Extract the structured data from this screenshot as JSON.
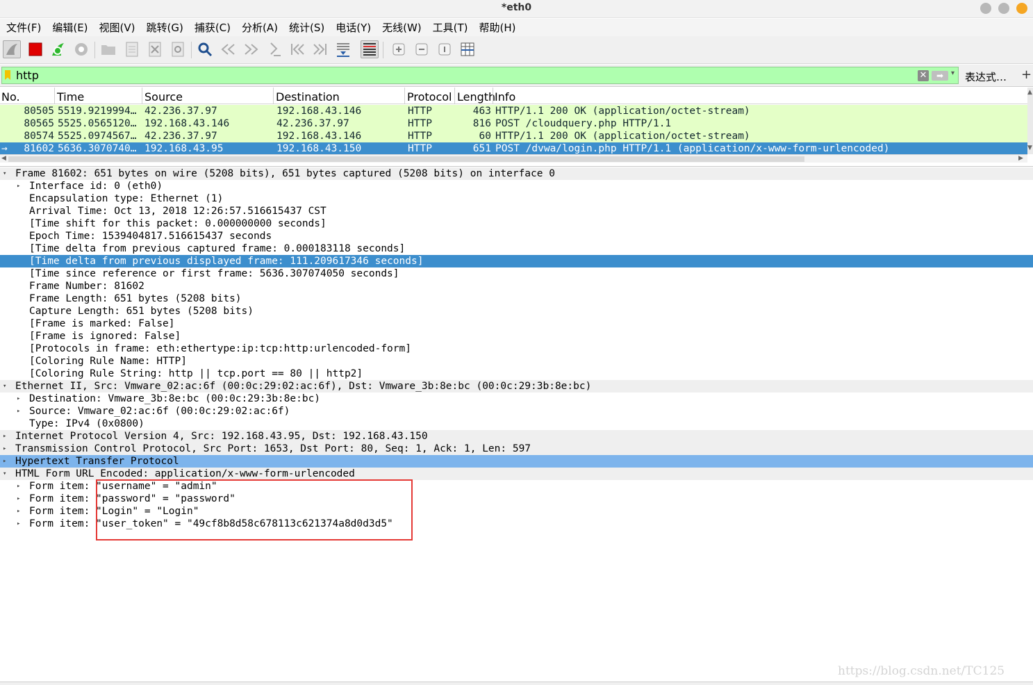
{
  "window": {
    "title": "*eth0"
  },
  "menu": [
    "文件(F)",
    "编辑(E)",
    "视图(V)",
    "跳转(G)",
    "捕获(C)",
    "分析(A)",
    "统计(S)",
    "电话(Y)",
    "无线(W)",
    "工具(T)",
    "帮助(H)"
  ],
  "toolbar": {
    "icons": [
      "shark-fin-start-icon",
      "stop-capture-icon",
      "restart-capture-icon",
      "capture-options-icon",
      "open-file-icon",
      "save-file-icon",
      "close-file-icon",
      "reload-file-icon",
      "find-packet-icon",
      "go-back-icon",
      "go-forward-icon",
      "go-to-packet-icon",
      "first-packet-icon",
      "last-packet-icon",
      "autoscroll-icon",
      "colorize-icon",
      "zoom-in-icon",
      "zoom-out-icon",
      "normal-size-icon",
      "resize-columns-icon"
    ]
  },
  "filter": {
    "value": "http",
    "expression_label": "表达式…",
    "add_label": "+"
  },
  "packet_list": {
    "columns": [
      "No.",
      "Time",
      "Source",
      "Destination",
      "Protocol",
      "Length",
      "Info"
    ],
    "rows": [
      {
        "no": "80505",
        "time": "5519.9219994…",
        "src": "42.236.37.97",
        "dst": "192.168.43.146",
        "proto": "HTTP",
        "len": "463",
        "info": "HTTP/1.1 200 OK  (application/octet-stream)"
      },
      {
        "no": "80565",
        "time": "5525.0565120…",
        "src": "192.168.43.146",
        "dst": "42.236.37.97",
        "proto": "HTTP",
        "len": "816",
        "info": "POST /cloudquery.php HTTP/1.1"
      },
      {
        "no": "80574",
        "time": "5525.0974567…",
        "src": "42.236.37.97",
        "dst": "192.168.43.146",
        "proto": "HTTP",
        "len": "60",
        "info": "HTTP/1.1 200 OK  (application/octet-stream)"
      },
      {
        "no": "81602",
        "time": "5636.3070740…",
        "src": "192.168.43.95",
        "dst": "192.168.43.150",
        "proto": "HTTP",
        "len": "651",
        "info": "POST /dvwa/login.php HTTP/1.1  (application/x-www-form-urlencoded)"
      }
    ]
  },
  "details": [
    {
      "level": 0,
      "tri": "▾",
      "text": "Frame 81602: 651 bytes on wire (5208 bits), 651 bytes captured (5208 bits) on interface 0"
    },
    {
      "level": 1,
      "tri": "▸",
      "text": "Interface id: 0 (eth0)"
    },
    {
      "level": 1,
      "tri": "",
      "text": "Encapsulation type: Ethernet (1)"
    },
    {
      "level": 1,
      "tri": "",
      "text": "Arrival Time: Oct 13, 2018 12:26:57.516615437 CST"
    },
    {
      "level": 1,
      "tri": "",
      "text": "[Time shift for this packet: 0.000000000 seconds]"
    },
    {
      "level": 1,
      "tri": "",
      "text": "Epoch Time: 1539404817.516615437 seconds"
    },
    {
      "level": 1,
      "tri": "",
      "text": "[Time delta from previous captured frame: 0.000183118 seconds]"
    },
    {
      "level": 1,
      "tri": "",
      "text": "[Time delta from previous displayed frame: 111.209617346 seconds]"
    },
    {
      "level": 1,
      "tri": "",
      "text": "[Time since reference or first frame: 5636.307074050 seconds]"
    },
    {
      "level": 1,
      "tri": "",
      "text": "Frame Number: 81602"
    },
    {
      "level": 1,
      "tri": "",
      "text": "Frame Length: 651 bytes (5208 bits)"
    },
    {
      "level": 1,
      "tri": "",
      "text": "Capture Length: 651 bytes (5208 bits)"
    },
    {
      "level": 1,
      "tri": "",
      "text": "[Frame is marked: False]"
    },
    {
      "level": 1,
      "tri": "",
      "text": "[Frame is ignored: False]"
    },
    {
      "level": 1,
      "tri": "",
      "text": "[Protocols in frame: eth:ethertype:ip:tcp:http:urlencoded-form]"
    },
    {
      "level": 1,
      "tri": "",
      "text": "[Coloring Rule Name: HTTP]"
    },
    {
      "level": 1,
      "tri": "",
      "text": "[Coloring Rule String: http || tcp.port == 80 || http2]"
    },
    {
      "level": 0,
      "tri": "▾",
      "text": "Ethernet II, Src: Vmware_02:ac:6f (00:0c:29:02:ac:6f), Dst: Vmware_3b:8e:bc (00:0c:29:3b:8e:bc)"
    },
    {
      "level": 1,
      "tri": "▸",
      "text": "Destination: Vmware_3b:8e:bc (00:0c:29:3b:8e:bc)"
    },
    {
      "level": 1,
      "tri": "▸",
      "text": "Source: Vmware_02:ac:6f (00:0c:29:02:ac:6f)"
    },
    {
      "level": 1,
      "tri": "",
      "text": "Type: IPv4 (0x0800)"
    },
    {
      "level": 0,
      "tri": "▸",
      "text": "Internet Protocol Version 4, Src: 192.168.43.95, Dst: 192.168.43.150"
    },
    {
      "level": 0,
      "tri": "▸",
      "text": "Transmission Control Protocol, Src Port: 1653, Dst Port: 80, Seq: 1, Ack: 1, Len: 597"
    },
    {
      "level": 0,
      "tri": "▸",
      "text": "Hypertext Transfer Protocol"
    },
    {
      "level": 0,
      "tri": "▾",
      "text": "HTML Form URL Encoded: application/x-www-form-urlencoded"
    },
    {
      "level": 1,
      "tri": "▸",
      "text": "Form item: \"username\" = \"admin\""
    },
    {
      "level": 1,
      "tri": "▸",
      "text": "Form item: \"password\" = \"password\""
    },
    {
      "level": 1,
      "tri": "▸",
      "text": "Form item: \"Login\" = \"Login\""
    },
    {
      "level": 1,
      "tri": "▸",
      "text": "Form item: \"user_token\" = \"49cf8b8d58c678113c621374a8d0d3d5\""
    }
  ],
  "watermark": "https://blog.csdn.net/TC125",
  "colors": {
    "row_bg": "#e4ffc7",
    "selected": "#3c8ecd",
    "secondary_highlight": "#7db4ec",
    "filter_ok": "#afffaf",
    "annotation_box": "#e53935"
  }
}
